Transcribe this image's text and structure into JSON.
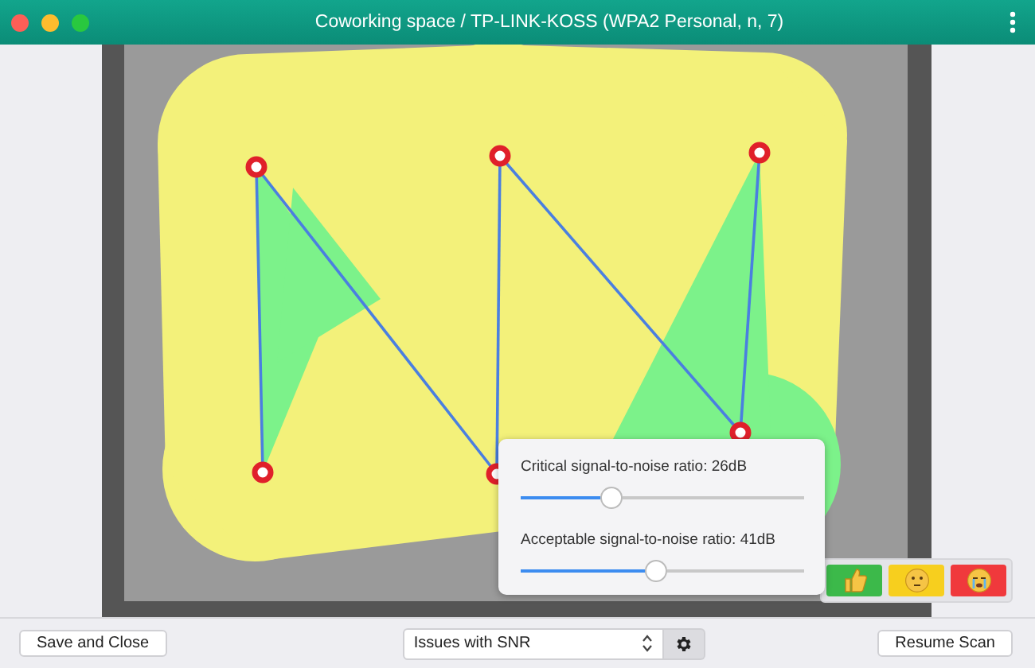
{
  "window": {
    "title": "Coworking space / TP-LINK-KOSS (WPA2 Personal, n, 7)"
  },
  "snr_popover": {
    "sliders": [
      {
        "label": "Critical signal-to-noise ratio: 26dB",
        "level": 0.32
      },
      {
        "label": "Acceptable signal-to-noise ratio: 41dB",
        "level": 0.48
      }
    ]
  },
  "legend": [
    {
      "kind": "thumbs-up",
      "color": "#3cb94a"
    },
    {
      "kind": "thinking",
      "color": "#f7cf1e"
    },
    {
      "kind": "crying",
      "color": "#f0393c"
    }
  ],
  "bottom_bar": {
    "save_button": "Save and Close",
    "view_dropdown": {
      "value": "Issues with SNR"
    },
    "resume_button": "Resume Scan"
  }
}
